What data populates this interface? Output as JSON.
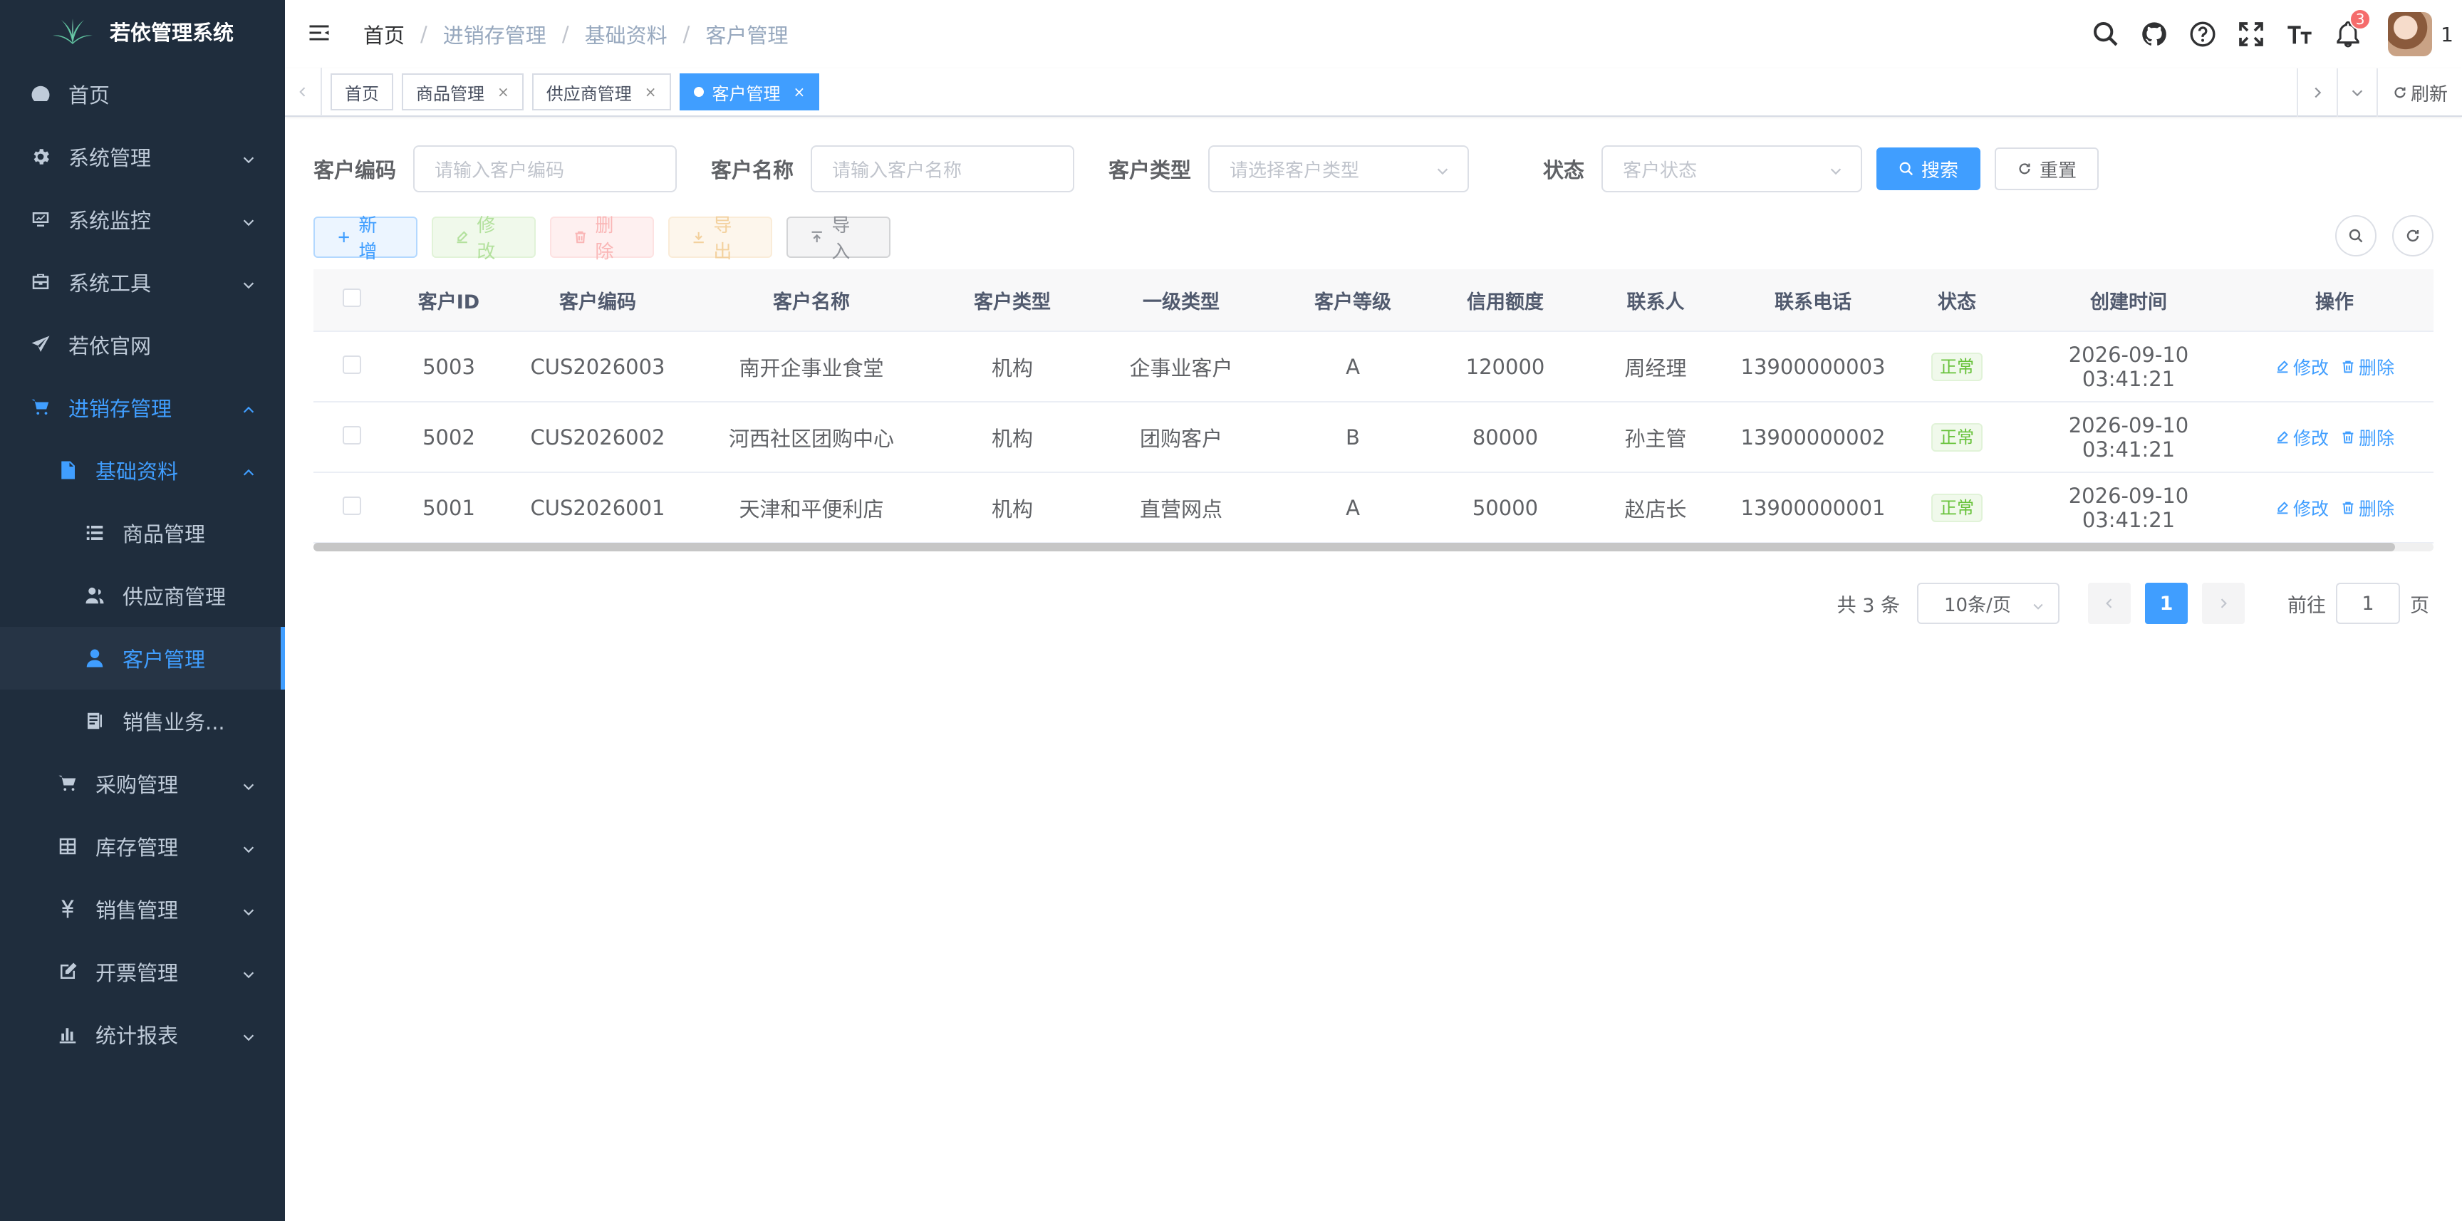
{
  "app": {
    "title": "若依管理系统"
  },
  "sidebar": {
    "items": [
      {
        "label": "首页",
        "icon": "dashboard-icon"
      },
      {
        "label": "系统管理",
        "icon": "gear-icon"
      },
      {
        "label": "系统监控",
        "icon": "monitor-icon"
      },
      {
        "label": "系统工具",
        "icon": "toolbox-icon"
      },
      {
        "label": "若依官网",
        "icon": "send-icon"
      },
      {
        "label": "进销存管理",
        "icon": "cart-icon"
      },
      {
        "label": "基础资料",
        "icon": "document-icon"
      },
      {
        "label": "商品管理",
        "icon": "list-icon"
      },
      {
        "label": "供应商管理",
        "icon": "users-icon"
      },
      {
        "label": "客户管理",
        "icon": "user-icon"
      },
      {
        "label": "销售业务...",
        "icon": "ledger-icon"
      },
      {
        "label": "采购管理",
        "icon": "cart-icon"
      },
      {
        "label": "库存管理",
        "icon": "grid-icon"
      },
      {
        "label": "销售管理",
        "icon": "yen-icon"
      },
      {
        "label": "开票管理",
        "icon": "edit-icon"
      },
      {
        "label": "统计报表",
        "icon": "bar-chart-icon"
      }
    ]
  },
  "navbar": {
    "breadcrumb": [
      "首页",
      "进销存管理",
      "基础资料",
      "客户管理"
    ],
    "notification_count": "3",
    "user_label": "1"
  },
  "tags": {
    "items": [
      "首页",
      "商品管理",
      "供应商管理",
      "客户管理"
    ],
    "refresh_label": "刷新"
  },
  "search": {
    "code_label": "客户编码",
    "code_placeholder": "请输入客户编码",
    "name_label": "客户名称",
    "name_placeholder": "请输入客户名称",
    "type_label": "客户类型",
    "type_placeholder": "请选择客户类型",
    "status_label": "状态",
    "status_placeholder": "客户状态",
    "search_button": "搜索",
    "reset_button": "重置"
  },
  "toolbar": {
    "add": "新增",
    "edit": "修改",
    "delete": "删除",
    "export": "导出",
    "import": "导入"
  },
  "table": {
    "headers": [
      "客户ID",
      "客户编码",
      "客户名称",
      "客户类型",
      "一级类型",
      "客户等级",
      "信用额度",
      "联系人",
      "联系电话",
      "状态",
      "创建时间",
      "操作"
    ],
    "rows": [
      {
        "id": "5003",
        "code": "CUS2026003",
        "name": "南开企事业食堂",
        "type": "机构",
        "level1": "企事业客户",
        "grade": "A",
        "credit": "120000",
        "contact": "周经理",
        "phone": "13900000003",
        "status": "正常",
        "created": "2026-09-10 03:41:21"
      },
      {
        "id": "5002",
        "code": "CUS2026002",
        "name": "河西社区团购中心",
        "type": "机构",
        "level1": "团购客户",
        "grade": "B",
        "credit": "80000",
        "contact": "孙主管",
        "phone": "13900000002",
        "status": "正常",
        "created": "2026-09-10 03:41:21"
      },
      {
        "id": "5001",
        "code": "CUS2026001",
        "name": "天津和平便利店",
        "type": "机构",
        "level1": "直营网点",
        "grade": "A",
        "credit": "50000",
        "contact": "赵店长",
        "phone": "13900000001",
        "status": "正常",
        "created": "2026-09-10 03:41:21"
      }
    ],
    "op_edit": "修改",
    "op_delete": "删除"
  },
  "pagination": {
    "total": "共 3 条",
    "page_size": "10条/页",
    "current_page": "1",
    "goto_label": "前往",
    "goto_value": "1",
    "page_suffix": "页"
  },
  "colors": {
    "sidebar_bg": "#1f2d3d",
    "primary": "#409eff",
    "success": "#67c23a"
  }
}
